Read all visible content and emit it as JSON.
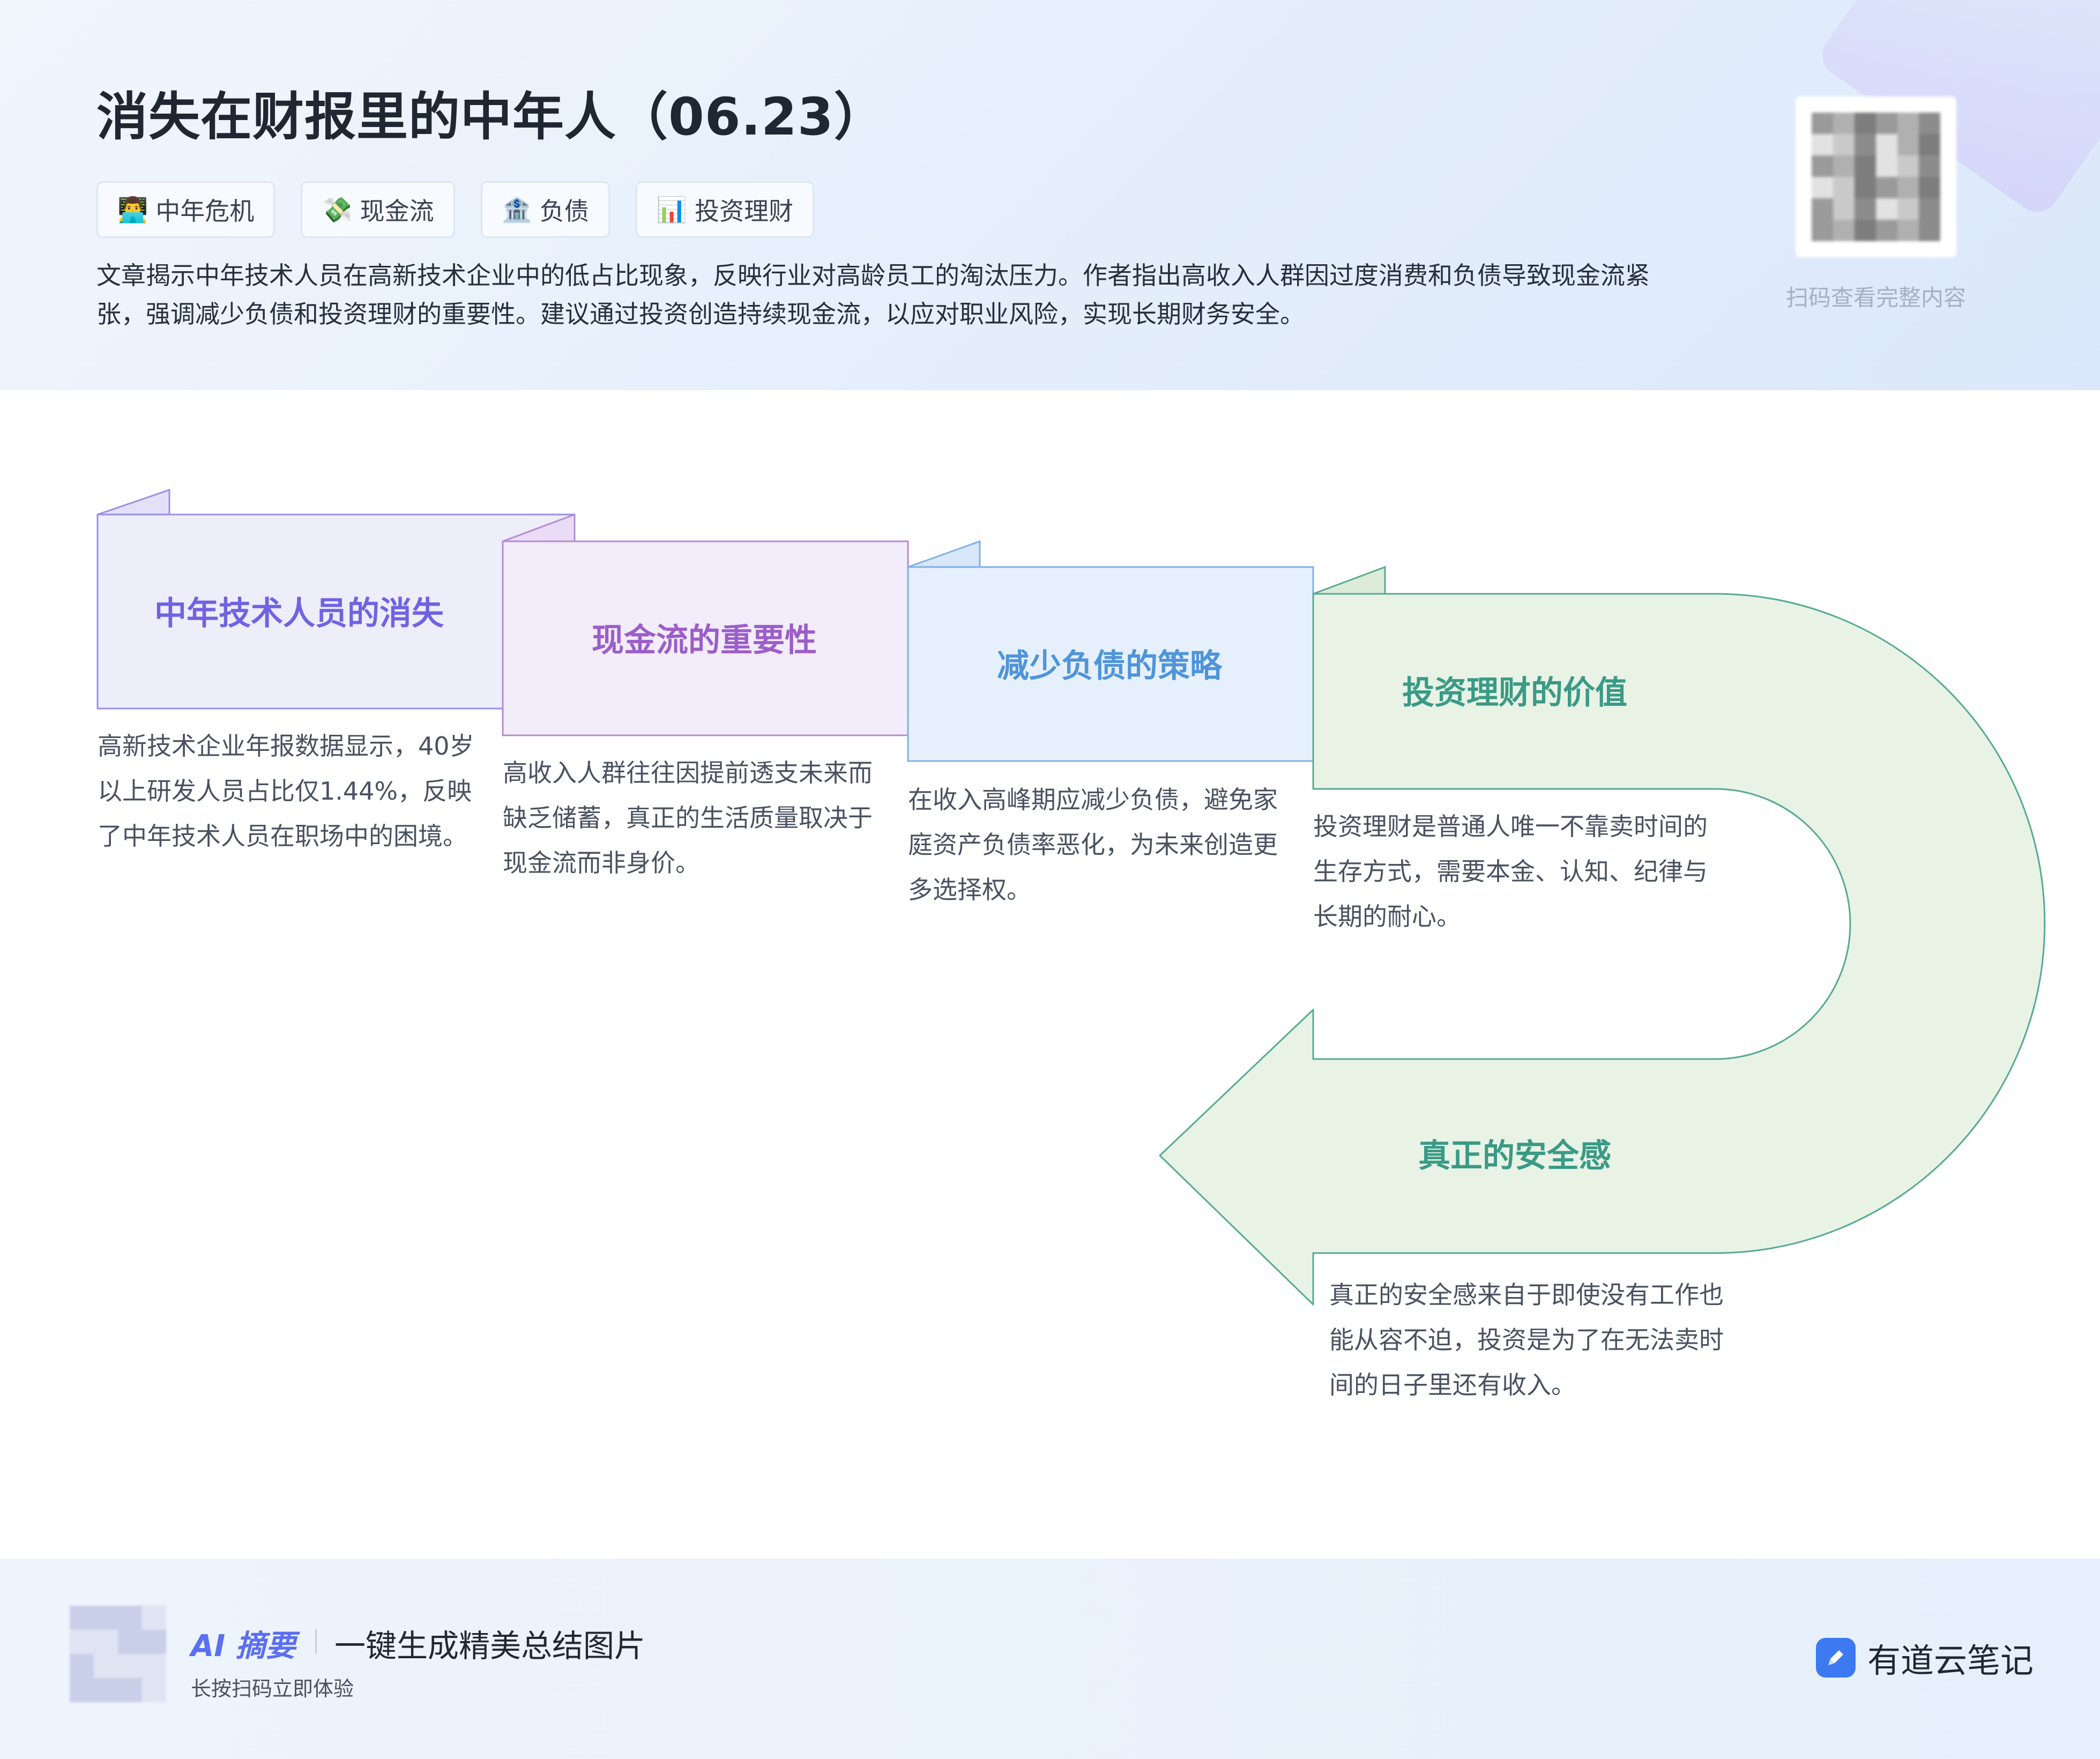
{
  "header": {
    "title": "消失在财报里的中年人（06.23）",
    "tags": [
      {
        "emoji": "👨‍💻",
        "label": "中年危机"
      },
      {
        "emoji": "💸",
        "label": "现金流"
      },
      {
        "emoji": "🏦",
        "label": "负债"
      },
      {
        "emoji": "📊",
        "label": "投资理财"
      }
    ],
    "summary": "文章揭示中年技术人员在高新技术企业中的低占比现象，反映行业对高龄员工的淘汰压力。作者指出高收入人群因过度消费和负债导致现金流紧张，强调减少负债和投资理财的重要性。建议通过投资创造持续现金流，以应对职业风险，实现长期财务安全。",
    "qr_caption": "扫码查看完整内容"
  },
  "steps": [
    {
      "title": "中年技术人员的消失",
      "desc": "高新技术企业年报数据显示，40岁以上研发人员占比仅1.44%，反映了中年技术人员在职场中的困境。",
      "color": "#6f63e3",
      "fill": "#eeedfa",
      "stroke": "#9a8fe6"
    },
    {
      "title": "现金流的重要性",
      "desc": "高收入人群往往因提前透支未来而缺乏储蓄，真正的生活质量取决于现金流而非身价。",
      "color": "#9b5ec9",
      "fill": "#f3ecfb",
      "stroke": "#b58ad8"
    },
    {
      "title": "减少负债的策略",
      "desc": "在收入高峰期应减少负债，避免家庭资产负债率恶化，为未来创造更多选择权。",
      "color": "#4f94d9",
      "fill": "#e6f0fc",
      "stroke": "#7fb1e6"
    },
    {
      "title": "投资理财的价值",
      "desc": "投资理财是普通人唯一不靠卖时间的生存方式，需要本金、认知、纪律与长期的耐心。",
      "color": "#3a9a85",
      "fill": "#e8f3e6",
      "stroke": "#58aa92"
    },
    {
      "title": "真正的安全感",
      "desc": "真正的安全感来自于即使没有工作也能从容不迫，投资是为了在无法卖时间的日子里还有收入。",
      "color": "#3a9a85",
      "fill": "#e8f3e6",
      "stroke": "#58aa92"
    }
  ],
  "footer": {
    "ai_label": "AI 摘要",
    "slogan": "一键生成精美总结图片",
    "sub": "长按扫码立即体验",
    "brand": "有道云笔记"
  }
}
